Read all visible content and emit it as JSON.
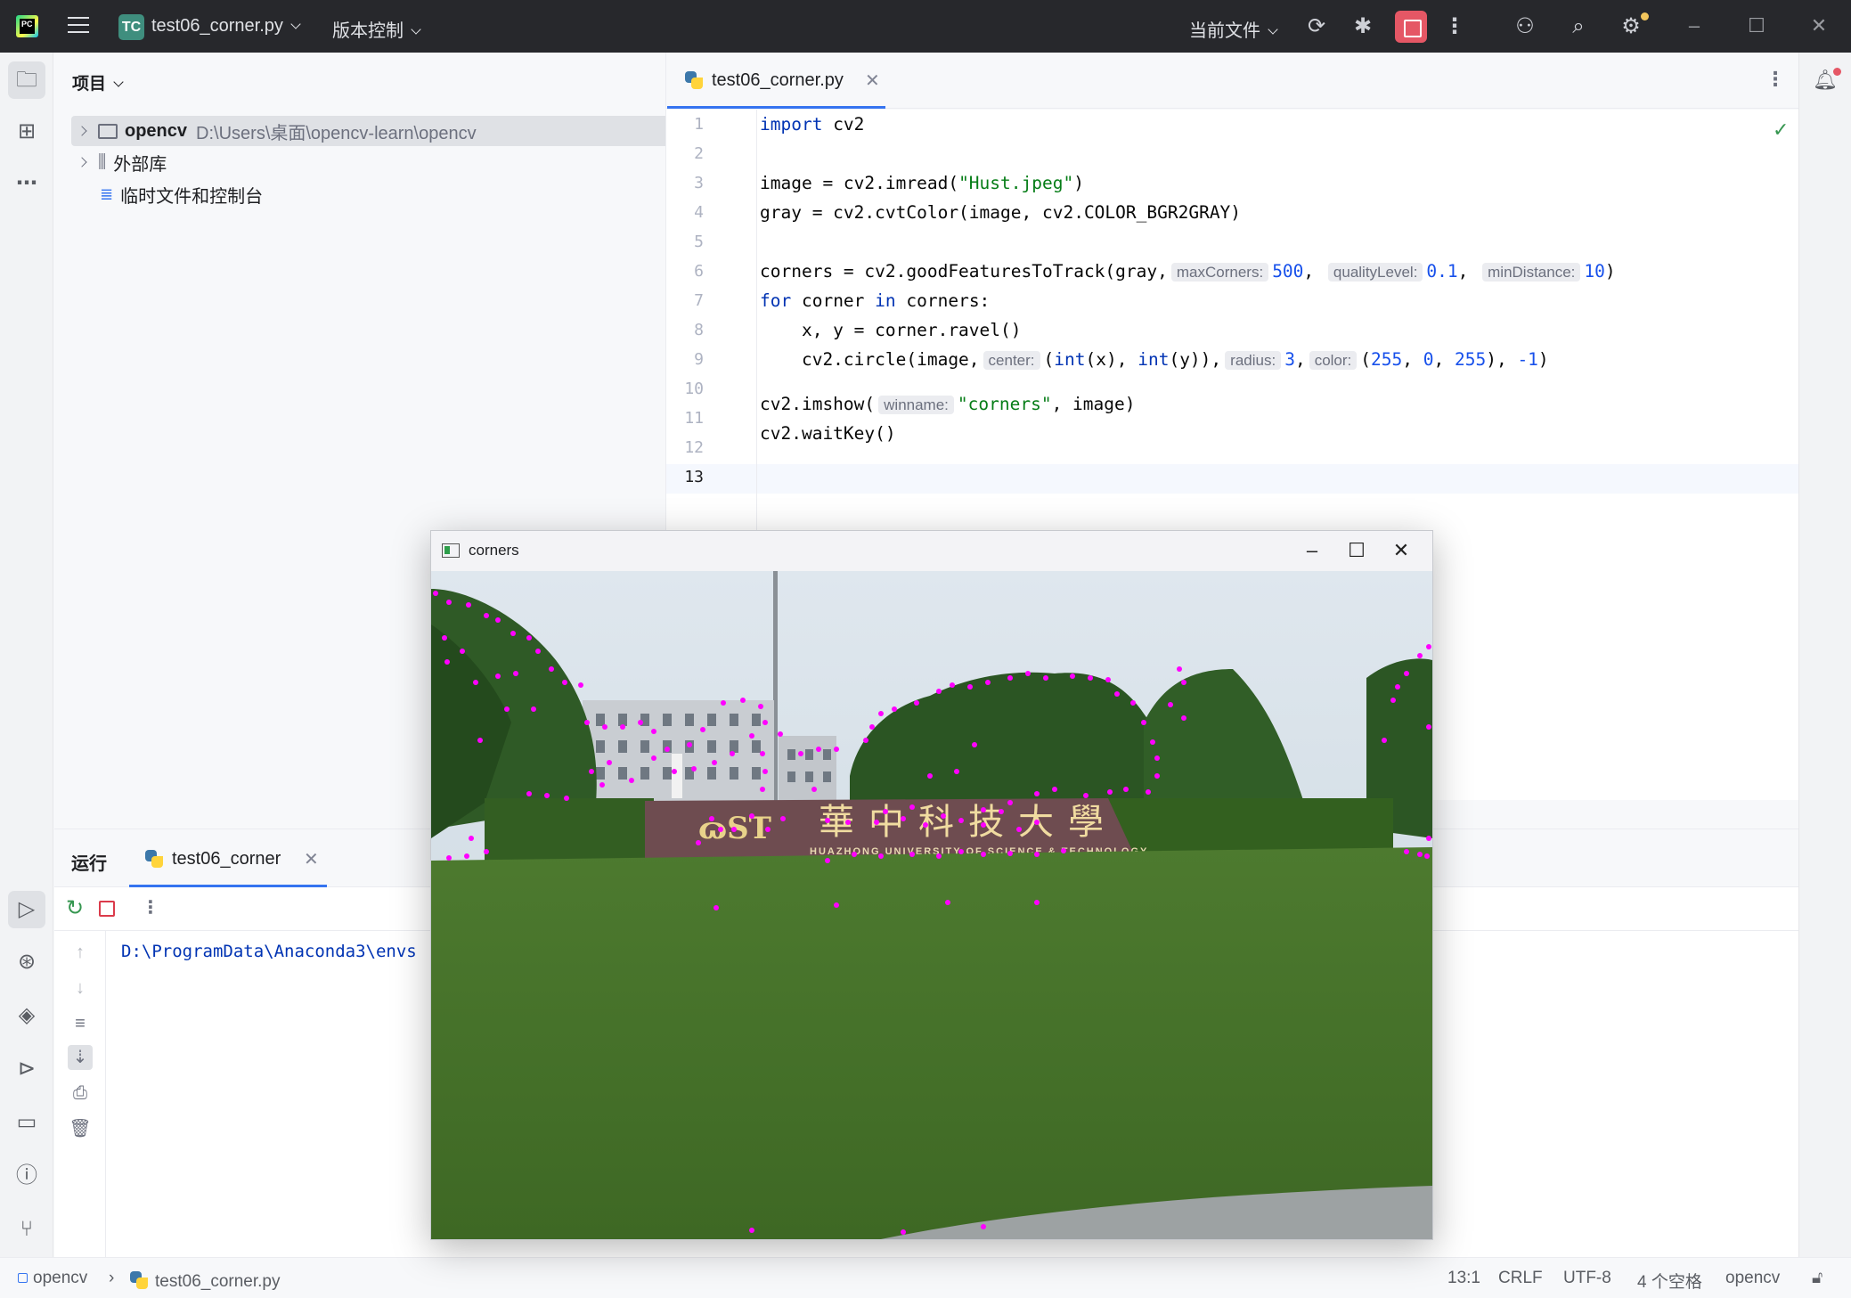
{
  "titlebar": {
    "project_badge": "TC",
    "file_name": "test06_corner.py",
    "vcs_label": "版本控制",
    "run_config": "当前文件"
  },
  "project_panel": {
    "header": "项目",
    "tree": [
      {
        "name": "opencv",
        "path": "D:\\Users\\桌面\\opencv-learn\\opencv"
      },
      {
        "name": "外部库"
      },
      {
        "name": "临时文件和控制台"
      }
    ]
  },
  "editor": {
    "tab_title": "test06_corner.py",
    "line_numbers": [
      "1",
      "2",
      "3",
      "4",
      "5",
      "6",
      "7",
      "8",
      "9",
      "10",
      "11",
      "12",
      "13"
    ],
    "code": {
      "l1": {
        "kw": "import",
        "rest": " cv2"
      },
      "l3": {
        "pre": "image = cv2.imread(",
        "str": "\"Hust.jpeg\"",
        "post": ")"
      },
      "l4": {
        "text": "gray = cv2.cvtColor(image, cv2.COLOR_BGR2GRAY)"
      },
      "l6": {
        "pre": "corners = cv2.goodFeaturesToTrack(gray,",
        "hint1": "maxCorners:",
        "v1": "500",
        "hint2": "qualityLevel:",
        "v2": "0.1",
        "hint3": "minDistance:",
        "v3": "10",
        "post": ")"
      },
      "l7": {
        "kw1": "for",
        "mid": " corner ",
        "kw2": "in",
        "rest": " corners:"
      },
      "l8": {
        "text": "    x, y = corner.ravel()"
      },
      "l9": {
        "pre": "    cv2.circle(image,",
        "hint1": "center:",
        "p1": "(",
        "int1": "int",
        "p2": "(x), ",
        "int2": "int",
        "p3": "(y)),",
        "hint2": "radius:",
        "v1": "3",
        "hint3": "color:",
        "p4": "(",
        "v2": "255",
        "v3": "0",
        "v4": "255",
        "v5": "-1"
      },
      "l11": {
        "pre": "cv2.imshow(",
        "hint": "winname:",
        "str": "\"corners\"",
        "post": ", image)"
      },
      "l12": {
        "text": "cv2.waitKey()"
      }
    }
  },
  "run_panel": {
    "label": "运行",
    "tab_title": "test06_corner",
    "console_line": "D:\\ProgramData\\Anaconda3\\envs"
  },
  "statusbar": {
    "project": "opencv",
    "file": "test06_corner.py",
    "position": "13:1",
    "line_ending": "CRLF",
    "encoding": "UTF-8",
    "indent": "4 个空格",
    "interpreter": "opencv"
  },
  "cv_window": {
    "title": "corners",
    "sign_text": "HUAZHONG UNIVERSITY OF SCIENCE & TECHNOLOGY",
    "sign_chinese": "華中科技大學",
    "corner_marker_color": "#ff00ff"
  },
  "colors": {
    "accent": "#3574f0",
    "stop_red": "#e55765",
    "keyword": "#0033b3",
    "string": "#067d17",
    "number": "#1750eb"
  }
}
